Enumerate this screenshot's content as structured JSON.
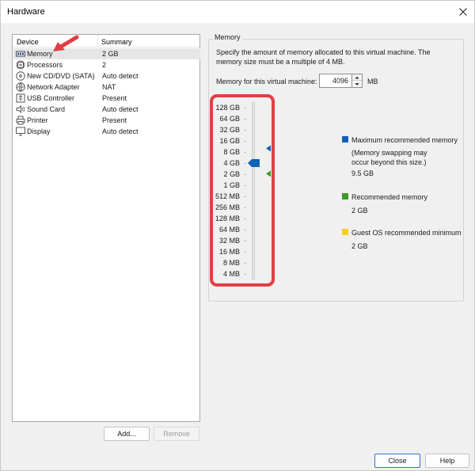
{
  "window": {
    "title": "Hardware"
  },
  "device_list": {
    "columns": {
      "device": "Device",
      "summary": "Summary"
    },
    "rows": [
      {
        "name": "Memory",
        "summary": "2 GB",
        "icon": "memory-icon"
      },
      {
        "name": "Processors",
        "summary": "2",
        "icon": "cpu-icon"
      },
      {
        "name": "New CD/DVD (SATA)",
        "summary": "Auto detect",
        "icon": "cd-dvd-icon"
      },
      {
        "name": "Network Adapter",
        "summary": "NAT",
        "icon": "network-icon"
      },
      {
        "name": "USB Controller",
        "summary": "Present",
        "icon": "usb-icon"
      },
      {
        "name": "Sound Card",
        "summary": "Auto detect",
        "icon": "speaker-icon"
      },
      {
        "name": "Printer",
        "summary": "Present",
        "icon": "printer-icon"
      },
      {
        "name": "Display",
        "summary": "Auto detect",
        "icon": "monitor-icon"
      }
    ],
    "selected": "Memory",
    "add_label": "Add...",
    "remove_label": "Remove"
  },
  "memory": {
    "group_title": "Memory",
    "description": "Specify the amount of memory allocated to this virtual machine. The memory size must be a multiple of 4 MB.",
    "field_label": "Memory for this virtual machine:",
    "value": "4096",
    "unit": "MB",
    "scale": [
      "128 GB",
      "64 GB",
      "32 GB",
      "16 GB",
      "8 GB",
      "4 GB",
      "2 GB",
      "1 GB",
      "512 MB",
      "256 MB",
      "128 MB",
      "64 MB",
      "32 MB",
      "16 MB",
      "8 MB",
      "4 MB"
    ],
    "slider_value": "4 GB",
    "max_marker": "9.5 GB",
    "recommended_marker": "2 GB",
    "legend": {
      "max": {
        "label": "Maximum recommended memory",
        "note": "(Memory swapping may occur beyond this size.)",
        "value": "9.5 GB",
        "color": "#0e63b5"
      },
      "recommended": {
        "label": "Recommended memory",
        "value": "2 GB",
        "color": "#3b9a27"
      },
      "guest_min": {
        "label": "Guest OS recommended minimum",
        "value": "2 GB",
        "color": "#f3d21b"
      }
    }
  },
  "footer": {
    "close_label": "Close",
    "help_label": "Help"
  }
}
